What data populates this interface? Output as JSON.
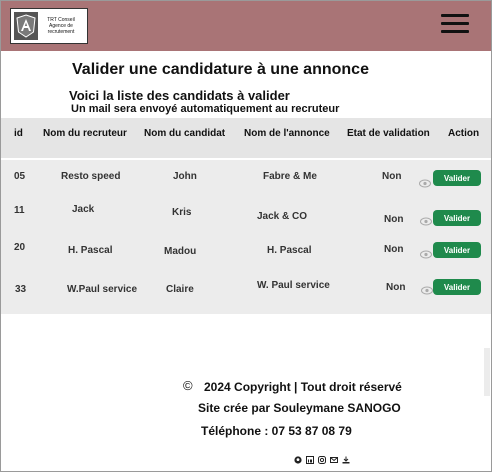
{
  "header": {
    "logo_line1": "TRT Conseil",
    "logo_line2": "Agence de",
    "logo_line3": "recrutement"
  },
  "page": {
    "title": "Valider une candidature à une annonce",
    "subtitle": "Voici la liste des candidats à valider",
    "note": "Un mail sera envoyé automatiquement au recruteur"
  },
  "table": {
    "headers": [
      "id",
      "Nom du recruteur",
      "Nom du candidat",
      "Nom de l'annonce",
      "Etat de validation",
      "Action"
    ],
    "rows": [
      {
        "id": "05",
        "recruteur": "Resto speed",
        "candidat": "John",
        "annonce": "Fabre & Me",
        "etat": "Non",
        "action": "Valider"
      },
      {
        "id": "11",
        "recruteur": "Jack",
        "candidat": "Kris",
        "annonce": "Jack & CO",
        "etat": "Non",
        "action": "Valider"
      },
      {
        "id": "20",
        "recruteur": "H. Pascal",
        "candidat": "Madou",
        "annonce": "H. Pascal",
        "etat": "Non",
        "action": "Valider"
      },
      {
        "id": "33",
        "recruteur": "W.Paul service",
        "candidat": "Claire",
        "annonce": "W. Paul service",
        "etat": "Non",
        "action": "Valider"
      }
    ]
  },
  "footer": {
    "copyright_symbol": "©",
    "copyright": "2024 Copyright | Tout droit réservé",
    "credit": "Site crée par Souleymane SANOGO",
    "phone": "Téléphone : 07 53 87 08 79",
    "social_icons": [
      "github-icon",
      "linkedin-icon",
      "instagram-icon",
      "mail-icon",
      "download-icon"
    ]
  },
  "colors": {
    "header_bg": "#a97476",
    "button_green": "#1f8a4c",
    "table_bg": "#ececec"
  }
}
